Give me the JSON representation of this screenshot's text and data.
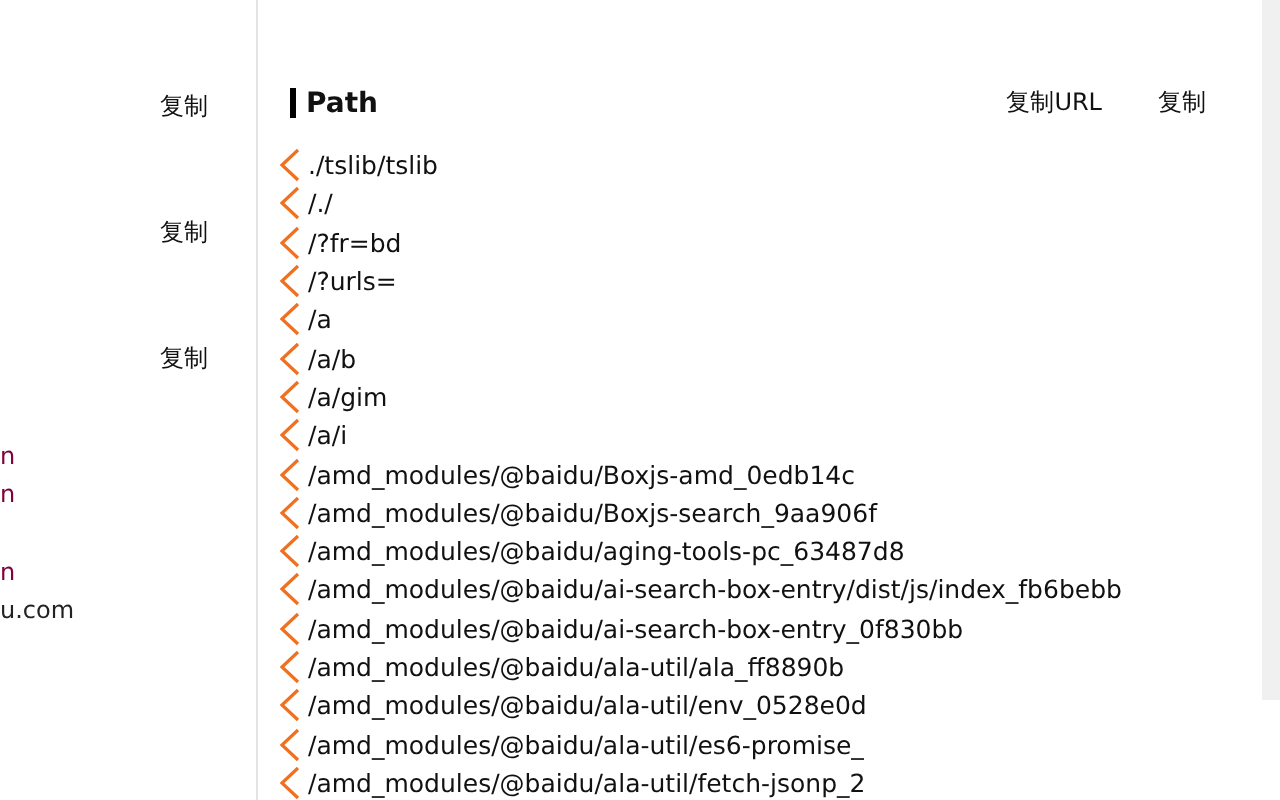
{
  "left_panel": {
    "copy_buttons": [
      "复制",
      "复制",
      "复制"
    ],
    "fragments": [
      {
        "text": "n",
        "kind": "link"
      },
      {
        "text": "n",
        "kind": "link"
      },
      {
        "text": "n",
        "kind": "link"
      },
      {
        "text": "u.com",
        "kind": "plain"
      }
    ]
  },
  "path_panel": {
    "title": "Path",
    "actions": [
      "复制URL",
      "复制"
    ],
    "paths": [
      "./tslib/tslib",
      "/./",
      "/?fr=bd",
      "/?urls=",
      "/a",
      "/a/b",
      "/a/gim",
      "/a/i",
      "/amd_modules/@baidu/Boxjs-amd_0edb14c",
      "/amd_modules/@baidu/Boxjs-search_9aa906f",
      "/amd_modules/@baidu/aging-tools-pc_63487d8",
      "/amd_modules/@baidu/ai-search-box-entry/dist/js/index_fb6bebb",
      "/amd_modules/@baidu/ai-search-box-entry_0f830bb",
      "/amd_modules/@baidu/ala-util/ala_ff8890b",
      "/amd_modules/@baidu/ala-util/env_0528e0d",
      "/amd_modules/@baidu/ala-util/es6-promise_",
      "/amd_modules/@baidu/ala-util/fetch-jsonp_2"
    ]
  }
}
